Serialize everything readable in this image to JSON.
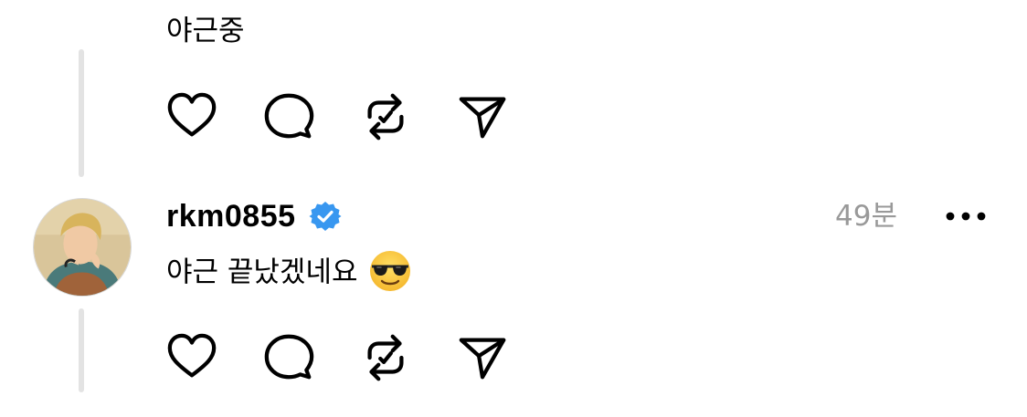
{
  "post1": {
    "text": "야근중",
    "actions": {
      "like_icon": "heart-icon",
      "reply_icon": "comment-icon",
      "repost_icon": "repost-icon",
      "share_icon": "send-icon"
    }
  },
  "post2": {
    "username": "rkm0855",
    "verified": true,
    "verified_color": "#3897f0",
    "timestamp": "49분",
    "text": "야근 끝났겠네요",
    "emoji": "sunglasses-face",
    "more_icon": "more-icon",
    "actions": {
      "like_icon": "heart-icon",
      "reply_icon": "comment-icon",
      "repost_icon": "repost-icon",
      "share_icon": "send-icon"
    }
  },
  "colors": {
    "text": "#000000",
    "muted": "#999999",
    "thread_line": "#e3e3e3"
  }
}
